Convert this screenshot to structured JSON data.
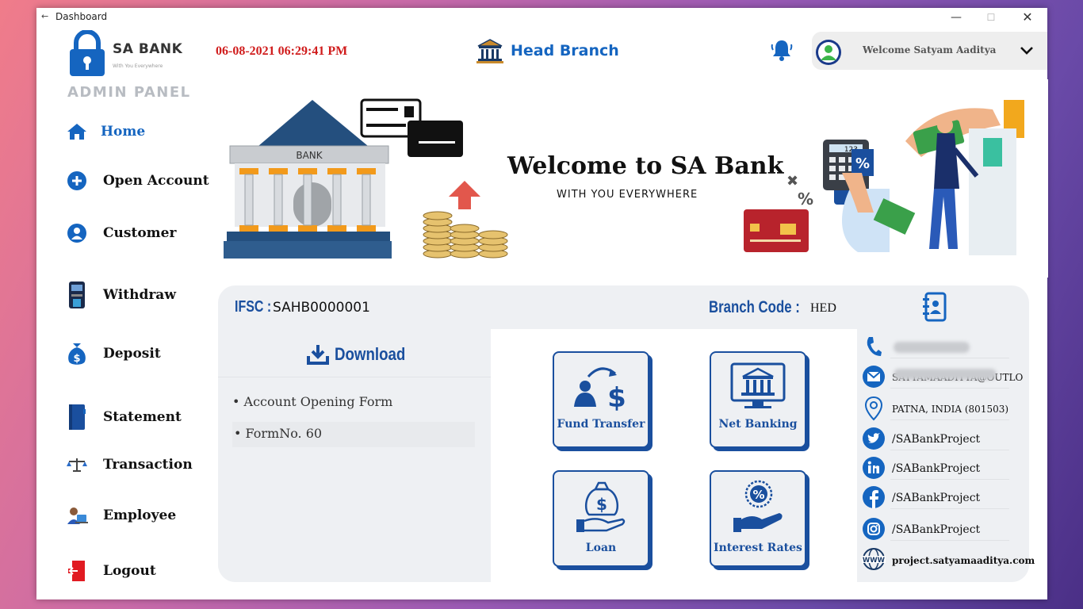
{
  "window": {
    "title": "Dashboard"
  },
  "brand": {
    "name": "SA BANK",
    "tagline": "With You Everywhere",
    "panel_label": "ADMIN PANEL"
  },
  "header": {
    "datetime": "06-08-2021 06:29:41 PM",
    "branch": "Head Branch",
    "welcome": "Welcome Satyam Aaditya"
  },
  "nav": {
    "items": [
      {
        "label": "Home",
        "icon": "home-icon"
      },
      {
        "label": "Open Account",
        "icon": "plus-circle-icon"
      },
      {
        "label": "Customer",
        "icon": "user-circle-icon"
      },
      {
        "label": "Withdraw",
        "icon": "atm-icon"
      },
      {
        "label": "Deposit",
        "icon": "money-bag-icon"
      },
      {
        "label": "Statement",
        "icon": "notebook-icon"
      },
      {
        "label": "Transaction",
        "icon": "scale-icon"
      },
      {
        "label": "Employee",
        "icon": "employee-icon"
      },
      {
        "label": "Logout",
        "icon": "logout-icon"
      }
    ],
    "active": "Home"
  },
  "hero": {
    "title": "Welcome to SA Bank",
    "subtitle": "WITH YOU EVERYWHERE",
    "bank_sign": "BANK",
    "calculator_display": "123"
  },
  "info": {
    "ifsc_label": "IFSC :",
    "ifsc_value": "SAHB0000001",
    "branch_code_label": "Branch Code :",
    "branch_code_value": "HED"
  },
  "downloads": {
    "title": "Download",
    "items": [
      "• Account Opening Form",
      "• FormNo. 60"
    ]
  },
  "tiles": [
    {
      "label": "Fund Transfer",
      "icon": "fund-transfer-icon"
    },
    {
      "label": "Net Banking",
      "icon": "net-banking-icon"
    },
    {
      "label": "Loan",
      "icon": "loan-icon"
    },
    {
      "label": "Interest Rates",
      "icon": "interest-rates-icon"
    }
  ],
  "contact": {
    "email_fragment": "SATYAMAADITYA@OUTLO",
    "address": "PATNA, INDIA (801503)",
    "twitter": "/SABankProject",
    "linkedin": "/SABankProject",
    "facebook": "/SABankProject",
    "instagram": "/SABankProject",
    "website": "project.satyamaaditya.com"
  },
  "colors": {
    "accent": "#1565c0",
    "dark_accent": "#1a4f9e",
    "datetime": "#d01c1c",
    "panel_bg": "#eef0f3"
  }
}
